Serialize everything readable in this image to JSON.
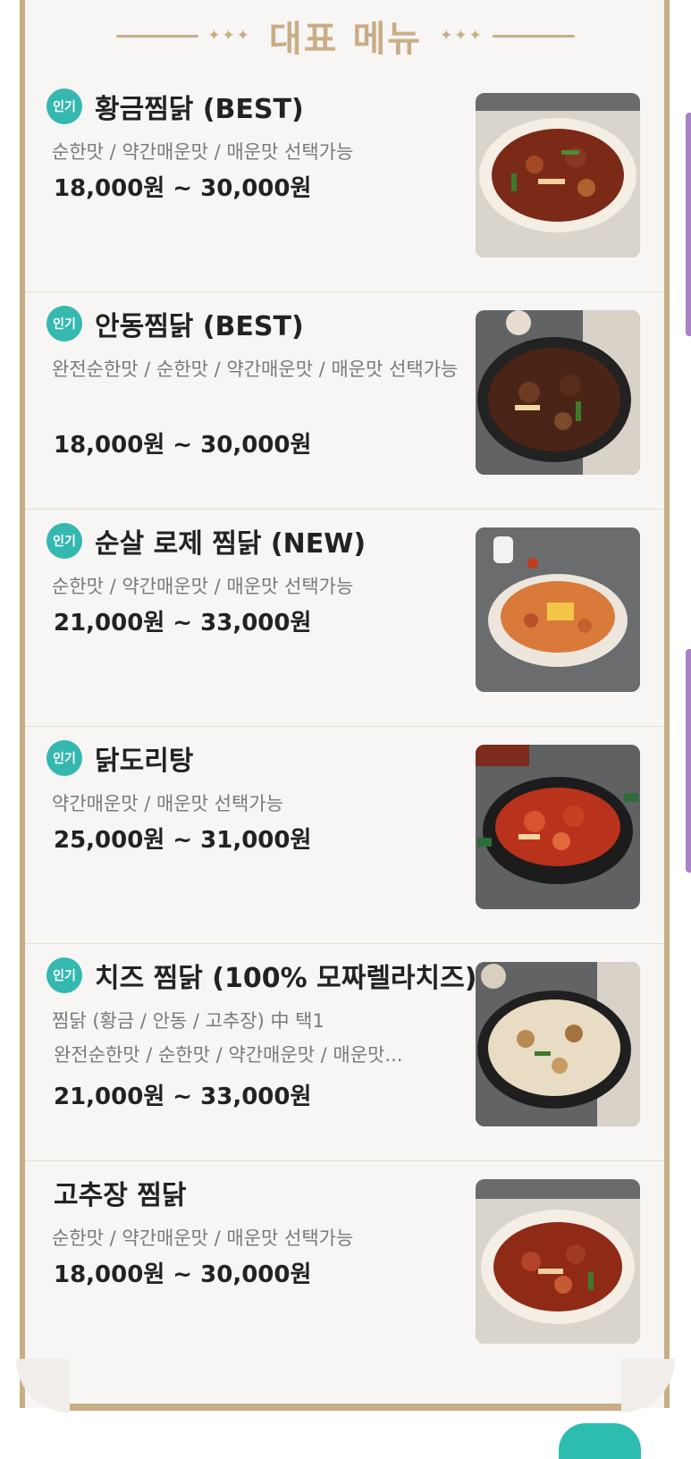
{
  "header": {
    "title": "대표 메뉴",
    "ornament_left": "✦✦✦",
    "ornament_right": "✦✦✦"
  },
  "items": [
    {
      "badge": "인기",
      "name": "황금찜닭 (BEST)",
      "flavors": "순한맛 / 약간매운맛 / 매운맛 선택가능",
      "price": "18,000원 ~ 30,000원",
      "image": "soy-braised-chicken-plate"
    },
    {
      "badge": "인기",
      "name": "안동찜닭 (BEST)",
      "flavors": "완전순한맛 / 순한맛 / 약간매운맛 / 매운맛 선택가능",
      "price": "18,000원 ~ 30,000원",
      "image": "andong-braised-chicken-pan"
    },
    {
      "badge": "인기",
      "name": "순살 로제 찜닭 (NEW)",
      "flavors": "순한맛 / 약간매운맛 / 매운맛 선택가능",
      "price": "21,000원 ~ 33,000원",
      "image": "rose-braised-chicken-dish"
    },
    {
      "badge": "인기",
      "name": "닭도리탕",
      "flavors": "약간매운맛 / 매운맛 선택가능",
      "price": "25,000원 ~ 31,000원",
      "image": "spicy-chicken-stew-pot"
    },
    {
      "badge": "인기",
      "name": "치즈 찜닭 (100% 모짜렐라치즈)",
      "flavors": "찜닭 (황금 / 안동 / 고추장) 中 택1",
      "flavors_2": "완전순한맛 / 순한맛 / 약간매운맛 / 매운맛...",
      "price": "21,000원 ~ 33,000원",
      "image": "cheese-braised-chicken-pan"
    },
    {
      "badge": "",
      "name": "고추장 찜닭",
      "flavors": "순한맛 / 약간매운맛 / 매운맛 선택가능",
      "price": "18,000원 ~ 30,000원",
      "image": "gochujang-braised-chicken-plate"
    }
  ],
  "colors": {
    "accent": "#c9ad85",
    "badge": "#34b8b0",
    "side_tab": "#a883c7",
    "float_button": "#2cbcb0"
  }
}
